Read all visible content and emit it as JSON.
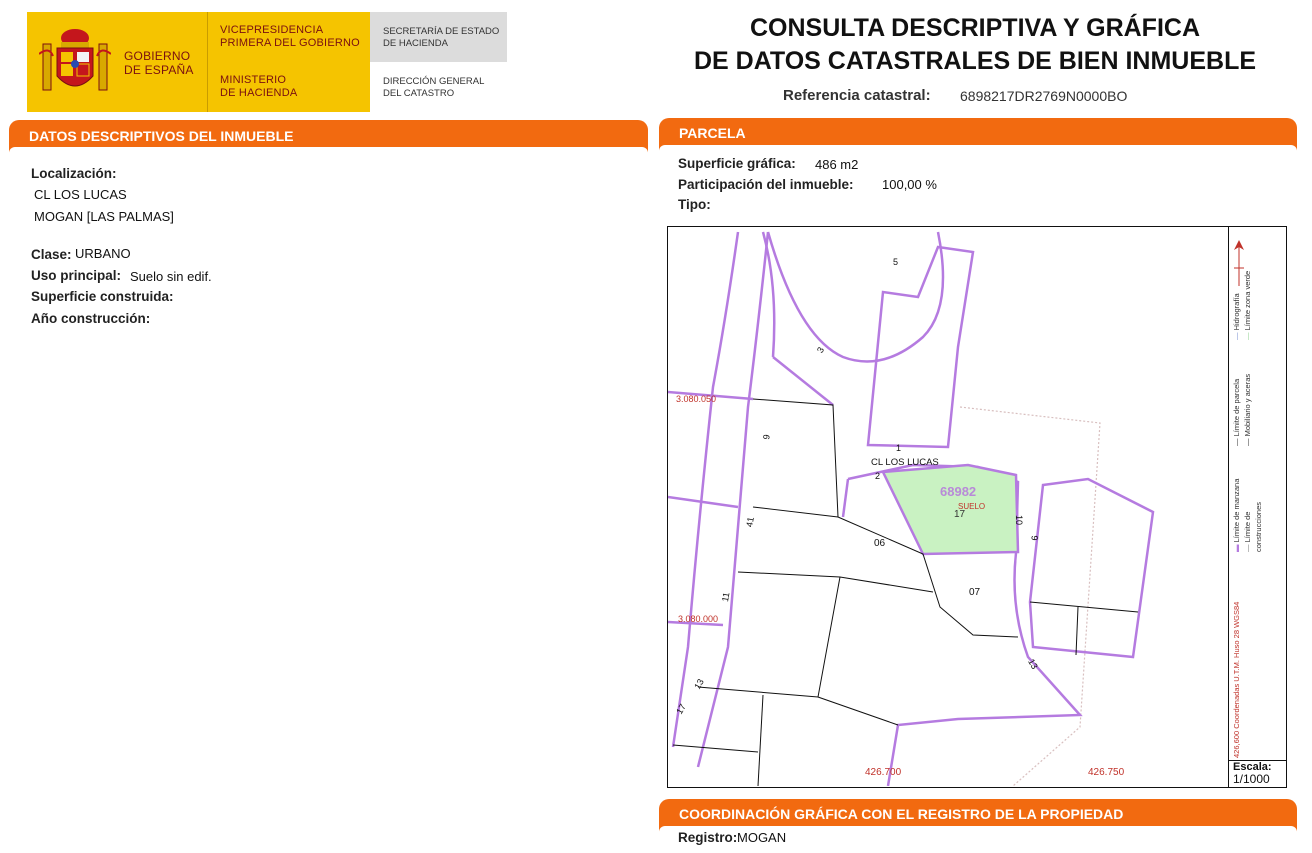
{
  "header": {
    "logo_gobierno": "GOBIERNO DE ESPAÑA",
    "logo_gobierno_l1": "GOBIERNO",
    "logo_gobierno_l2": "DE ESPAÑA",
    "vice_l1": "VICEPRESIDENCIA",
    "vice_l2": "PRIMERA DEL GOBIERNO",
    "min_l1": "MINISTERIO",
    "min_l2": "DE HACIENDA",
    "sec_l1": "SECRETARÍA DE ESTADO",
    "sec_l2": "DE HACIENDA",
    "dg_l1": "DIRECCIÓN GENERAL",
    "dg_l2": "DEL CATASTRO",
    "title_l1": "CONSULTA DESCRIPTIVA Y GRÁFICA",
    "title_l2": "DE DATOS CATASTRALES DE BIEN INMUEBLE",
    "ref_label": "Referencia catastral:",
    "ref_value": "6898217DR2769N0000BO"
  },
  "descriptivos": {
    "heading": "DATOS DESCRIPTIVOS DEL INMUEBLE",
    "localizacion_label": "Localización:",
    "localizacion_l1": "CL LOS LUCAS",
    "localizacion_l2": "MOGAN [LAS PALMAS]",
    "clase_label": "Clase:",
    "clase_value": "URBANO",
    "uso_label": "Uso principal:",
    "uso_value": "Suelo sin edif.",
    "superficie_label": "Superficie construida:",
    "anio_label": "Año construcción:"
  },
  "parcela": {
    "heading": "PARCELA",
    "superficie_label": "Superficie gráfica:",
    "superficie_value": "486 m2",
    "participacion_label": "Participación del inmueble:",
    "participacion_value": "100,00 %",
    "tipo_label": "Tipo:"
  },
  "map": {
    "street_label": "CL LOS LUCAS",
    "parcel_id": "68982",
    "parcel_use": "SUELO",
    "parcel_num": "17",
    "labels": [
      "5",
      "3",
      "9",
      "41",
      "11",
      "13",
      "17",
      "1",
      "2",
      "06",
      "07",
      "10",
      "9",
      "13"
    ],
    "y_coord_1": "3.080.050",
    "y_coord_2": "3.080.000",
    "x_coord_1": "426.700",
    "x_coord_2": "426.750",
    "legend_items": [
      "Límite de manzana",
      "Límite de construcciones",
      "Límite de parcela",
      "Mobiliario y aceras",
      "Hidrografía",
      "Límite zona verde"
    ],
    "coords_note": "426,600 Coordenadas U.T.M. Huso 28 WGS84",
    "escala_label": "Escala:",
    "escala_value": "1/1000",
    "colors": {
      "block": "#b57be0",
      "parcel_fill": "#c9f2c2",
      "coord_text": "#c0322a"
    }
  },
  "coordinacion": {
    "heading": "COORDINACIÓN GRÁFICA CON EL REGISTRO DE LA PROPIEDAD",
    "registro_label": "Registro:",
    "registro_value": "MOGAN"
  }
}
